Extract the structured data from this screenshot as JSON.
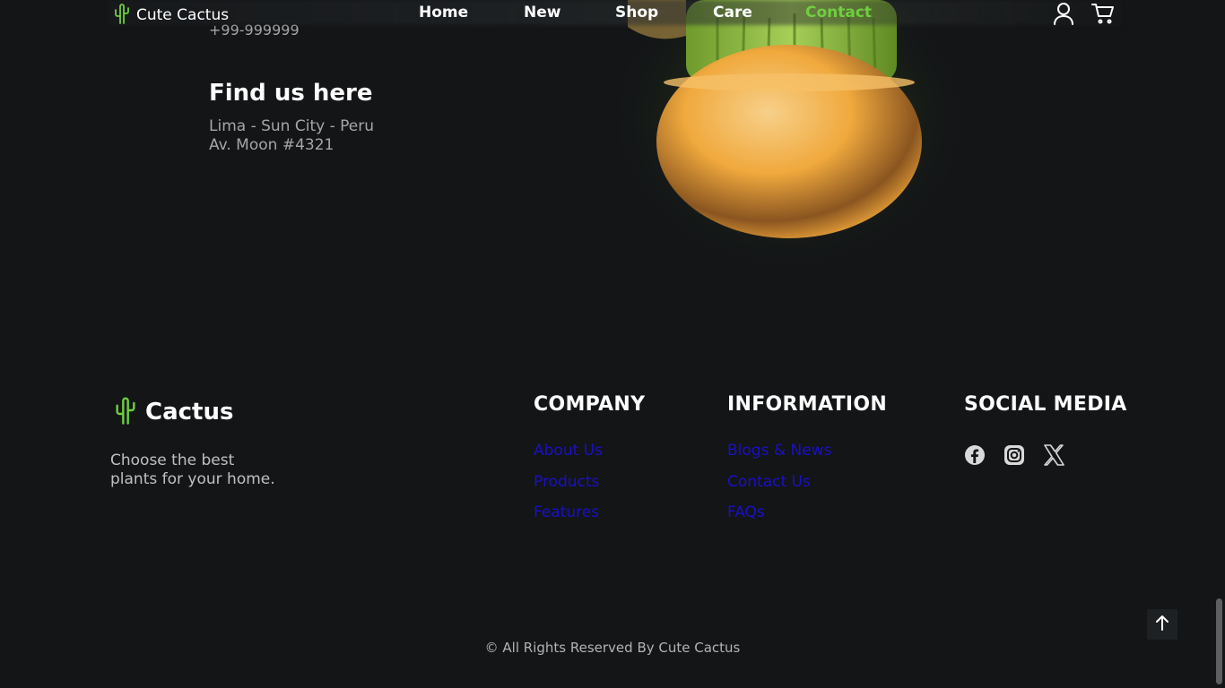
{
  "header": {
    "brand": "Cute Cactus",
    "nav": [
      {
        "label": "Home"
      },
      {
        "label": "New"
      },
      {
        "label": "Shop"
      },
      {
        "label": "Care"
      },
      {
        "label": "Contact",
        "active": true
      }
    ],
    "icons": [
      "user-icon",
      "cart-icon"
    ]
  },
  "contact": {
    "phone": "+99-999999",
    "find_title": "Find us here",
    "address_line1": "Lima - Sun City - Peru",
    "address_line2": "Av. Moon #4321"
  },
  "footer": {
    "brand": "Cactus",
    "description_line1": "Choose the best",
    "description_line2": "plants for your home.",
    "company": {
      "title": "COMPANY",
      "links": [
        "About Us",
        "Products",
        "Features"
      ]
    },
    "information": {
      "title": "INFORMATION",
      "links": [
        "Blogs & News",
        "Contact Us",
        "FAQs"
      ]
    },
    "social": {
      "title": "SOCIAL MEDIA",
      "icons": [
        "facebook-icon",
        "instagram-icon",
        "x-twitter-icon"
      ]
    },
    "copyright": "© All Rights Reserved By Cute Cactus"
  },
  "colors": {
    "background": "#131517",
    "accent": "#6fcf3f",
    "link": "#1a10c8",
    "muted_text": "#a6a6a6"
  }
}
